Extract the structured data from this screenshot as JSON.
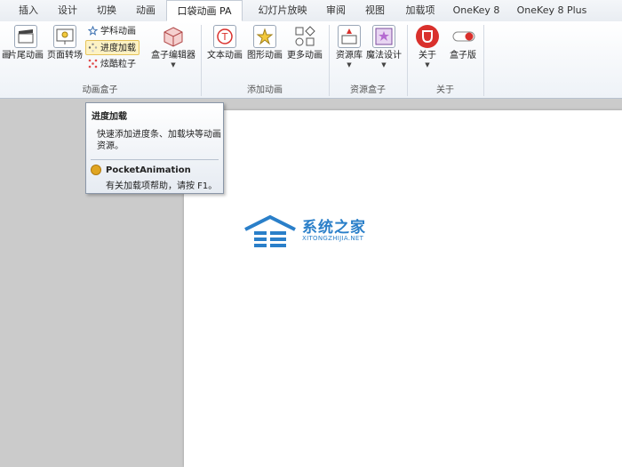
{
  "tabs": [
    {
      "label": "插入",
      "active": false
    },
    {
      "label": "设计",
      "active": false
    },
    {
      "label": "切换",
      "active": false
    },
    {
      "label": "动画",
      "active": false
    },
    {
      "label": "口袋动画 PA",
      "active": true
    },
    {
      "label": "幻灯片放映",
      "active": false
    },
    {
      "label": "审阅",
      "active": false
    },
    {
      "label": "视图",
      "active": false
    },
    {
      "label": "加载项",
      "active": false
    },
    {
      "label": "OneKey 8",
      "active": false
    },
    {
      "label": "OneKey 8 Plus",
      "active": false
    }
  ],
  "ribbon": {
    "groups": {
      "box": "动画盒子",
      "add": "添加动画",
      "resource": "资源盒子",
      "about": "关于"
    },
    "buttons": {
      "title_anim": "片尾动画",
      "page_trans": "页面转场",
      "subject_anim": "学科动画",
      "progress_load": "进度加载",
      "cool_particle": "炫酷粒子",
      "box_editor": "盒子编辑器",
      "text_anim": "文本动画",
      "shape_anim": "图形动画",
      "more_anim": "更多动画",
      "resource_lib": "资源库",
      "magic_design": "魔法设计",
      "about": "关于",
      "box_edition": "盒子版"
    },
    "partial_left_label": "画"
  },
  "tooltip": {
    "title": "进度加载",
    "description": "快速添加进度条、加载块等动画资源。",
    "addin_name": "PocketAnimation",
    "help": "有关加载项帮助，请按 F1。"
  },
  "watermark": {
    "name": "系统之家",
    "url": "XITONGZHIJIA.NET"
  },
  "colors": {
    "accent_red": "#d9302c",
    "watermark_blue": "#2a7fc9",
    "highlight": "#fdf2c4"
  }
}
